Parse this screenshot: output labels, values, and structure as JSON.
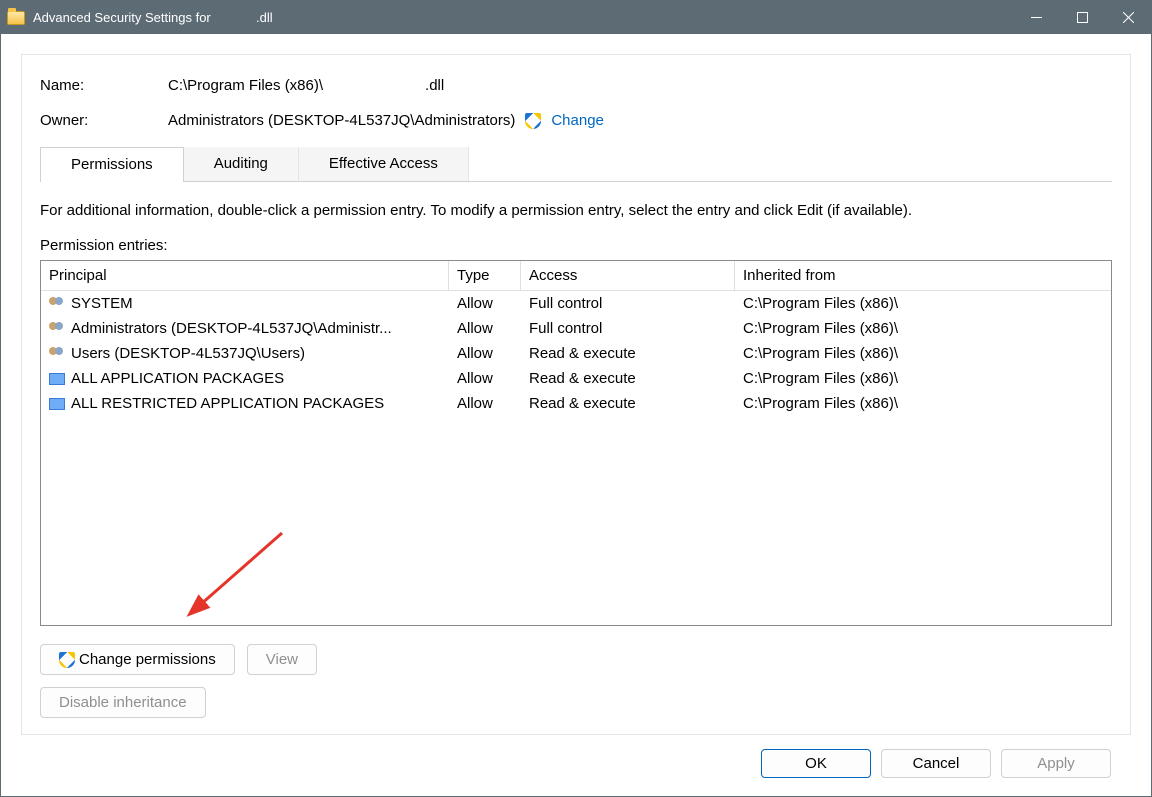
{
  "title_prefix": "Advanced Security Settings for",
  "title_file": ".dll",
  "name_label": "Name:",
  "name_value1": "C:\\Program Files (x86)\\",
  "name_value2": ".dll",
  "owner_label": "Owner:",
  "owner_value": "Administrators (DESKTOP-4L537JQ\\Administrators)",
  "change_link": "Change",
  "tabs": {
    "permissions": "Permissions",
    "auditing": "Auditing",
    "effective": "Effective Access"
  },
  "hint": "For additional information, double-click a permission entry. To modify a permission entry, select the entry and click Edit (if available).",
  "entries_label": "Permission entries:",
  "columns": {
    "principal": "Principal",
    "type": "Type",
    "access": "Access",
    "inherited": "Inherited from"
  },
  "rows": [
    {
      "icon": "users",
      "principal": "SYSTEM",
      "type": "Allow",
      "access": "Full control",
      "inherited": "C:\\Program Files (x86)\\"
    },
    {
      "icon": "users",
      "principal": "Administrators (DESKTOP-4L537JQ\\Administr...",
      "type": "Allow",
      "access": "Full control",
      "inherited": "C:\\Program Files (x86)\\"
    },
    {
      "icon": "users",
      "principal": "Users (DESKTOP-4L537JQ\\Users)",
      "type": "Allow",
      "access": "Read & execute",
      "inherited": "C:\\Program Files (x86)\\"
    },
    {
      "icon": "pkg",
      "principal": "ALL APPLICATION PACKAGES",
      "type": "Allow",
      "access": "Read & execute",
      "inherited": "C:\\Program Files (x86)\\"
    },
    {
      "icon": "pkg",
      "principal": "ALL RESTRICTED APPLICATION PACKAGES",
      "type": "Allow",
      "access": "Read & execute",
      "inherited": "C:\\Program Files (x86)\\"
    }
  ],
  "btn_change_perms": "Change permissions",
  "btn_view": "View",
  "btn_disable_inherit": "Disable inheritance",
  "btn_ok": "OK",
  "btn_cancel": "Cancel",
  "btn_apply": "Apply"
}
